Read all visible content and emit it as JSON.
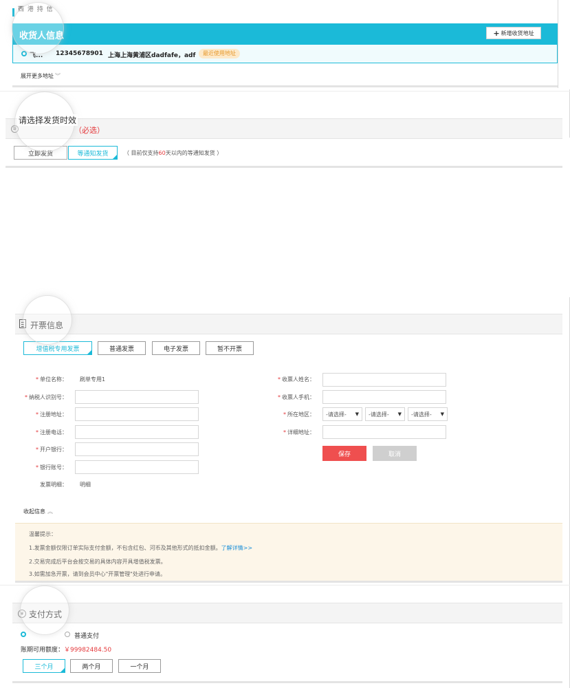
{
  "consignee": {
    "header_title": "收货人信息",
    "top_cut_text": "西 港 持 信",
    "add_address_label": "新增收货地址",
    "address": {
      "name": "飞...",
      "phone": "12345678901",
      "detail": "上海上海黄浦区dadfafe，adf",
      "badge": "最近使用地址"
    },
    "expand_more_label": "展开更多地址"
  },
  "delivery": {
    "title": "请选择发货时效",
    "required_text": "（必选）",
    "options": [
      {
        "label": "立即发货",
        "active": false
      },
      {
        "label": "等通知发货",
        "active": true
      }
    ],
    "note_prefix": "（ 目前仅支持",
    "note_days": "60",
    "note_suffix": "天以内的等通知发货 ）"
  },
  "invoice": {
    "title": "开票信息",
    "types": [
      {
        "label": "增值税专用发票",
        "active": true
      },
      {
        "label": "普通发票",
        "active": false
      },
      {
        "label": "电子发票",
        "active": false
      },
      {
        "label": "暂不开票",
        "active": false
      }
    ],
    "left_fields": [
      {
        "label": "单位名称：",
        "required": true,
        "value": "刷单专用1",
        "type": "text"
      },
      {
        "label": "纳税人识别号：",
        "required": true,
        "value": "",
        "type": "input"
      },
      {
        "label": "注册地址：",
        "required": true,
        "value": "",
        "type": "input"
      },
      {
        "label": "注册电话：",
        "required": true,
        "value": "",
        "type": "input"
      },
      {
        "label": "开户银行：",
        "required": true,
        "value": "",
        "type": "input"
      },
      {
        "label": "银行账号：",
        "required": true,
        "value": "",
        "type": "input"
      },
      {
        "label": "发票明细：",
        "required": false,
        "value": "明细",
        "type": "text"
      }
    ],
    "right_fields": {
      "receiver_name_label": "收票人姓名：",
      "receiver_phone_label": "收票人手机：",
      "region_label": "所在地区：",
      "region_selects": [
        "-请选择-",
        "-请选择-",
        "-请选择-"
      ],
      "address_label": "详细地址："
    },
    "save_label": "保存",
    "cancel_label": "取消",
    "collapse_label": "收起信息",
    "tips": {
      "title": "温馨提示：",
      "line1": "1.发票金额仅限订单实际支付金额，不包含红包、河币及其他形式的抵扣金额。",
      "line1_link": "了解详情>>",
      "line2": "2.交易完成后平台会按交易的具体内容开具增值税发票。",
      "line3": "3.如需加急开票，请到会员中心\"开票管理\"处进行申请。"
    }
  },
  "payment": {
    "title": "支付方式",
    "methods": [
      {
        "label": "",
        "checked": true
      },
      {
        "label": "普通支付",
        "checked": false
      }
    ],
    "credit_label": "账期可用额度：",
    "credit_amount": "￥99982484.50",
    "periods": [
      {
        "label": "三个月",
        "active": true
      },
      {
        "label": "两个月",
        "active": false
      },
      {
        "label": "一个月",
        "active": false
      }
    ]
  },
  "colors": {
    "accent": "#1bbad8",
    "danger": "#e4393c",
    "save_button": "#ef4f4f",
    "tips_bg": "#fdf6e9"
  }
}
